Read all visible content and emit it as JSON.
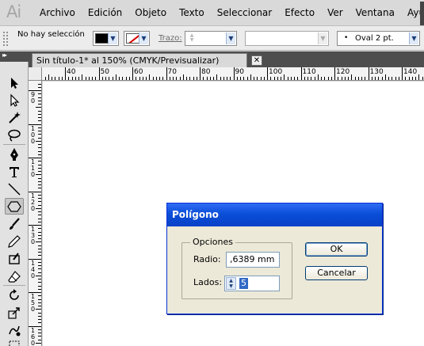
{
  "app": {
    "logo_text": "Ai"
  },
  "menu": [
    "Archivo",
    "Edición",
    "Objeto",
    "Texto",
    "Seleccionar",
    "Efecto",
    "Ver",
    "Ventana",
    "Ayuda"
  ],
  "control_panel": {
    "selection_status": "No hay selección",
    "fill_color": "#000000",
    "stroke_color": "none",
    "stroke_label": "Trazo:",
    "brush_value": "Oval 2 pt."
  },
  "document": {
    "tab_title": "Sin título-1* al 150% (CMYK/Previsualizar)",
    "close_glyph": "✕"
  },
  "ruler": {
    "horizontal": [
      "40",
      "50",
      "60",
      "70",
      "80",
      "90",
      "100",
      "110",
      "120",
      "130",
      "140"
    ],
    "vertical": [
      "90",
      "100",
      "110",
      "120",
      "130",
      "140",
      "150",
      "160"
    ]
  },
  "tools": [
    "selection-tool",
    "direct-selection-tool",
    "magic-wand-tool",
    "lasso-tool",
    "pen-tool",
    "type-tool",
    "line-segment-tool",
    "polygon-tool",
    "paintbrush-tool",
    "pencil-tool",
    "blob-brush-tool",
    "eraser-tool",
    "rotate-tool",
    "scale-tool",
    "warp-tool",
    "free-transform-tool"
  ],
  "dialog": {
    "title": "Polígono",
    "group_label": "Opciones",
    "radius_label": "Radio:",
    "radius_value": ",6389 mm",
    "sides_label": "Lados:",
    "sides_value": "5",
    "ok_label": "OK",
    "cancel_label": "Cancelar"
  }
}
